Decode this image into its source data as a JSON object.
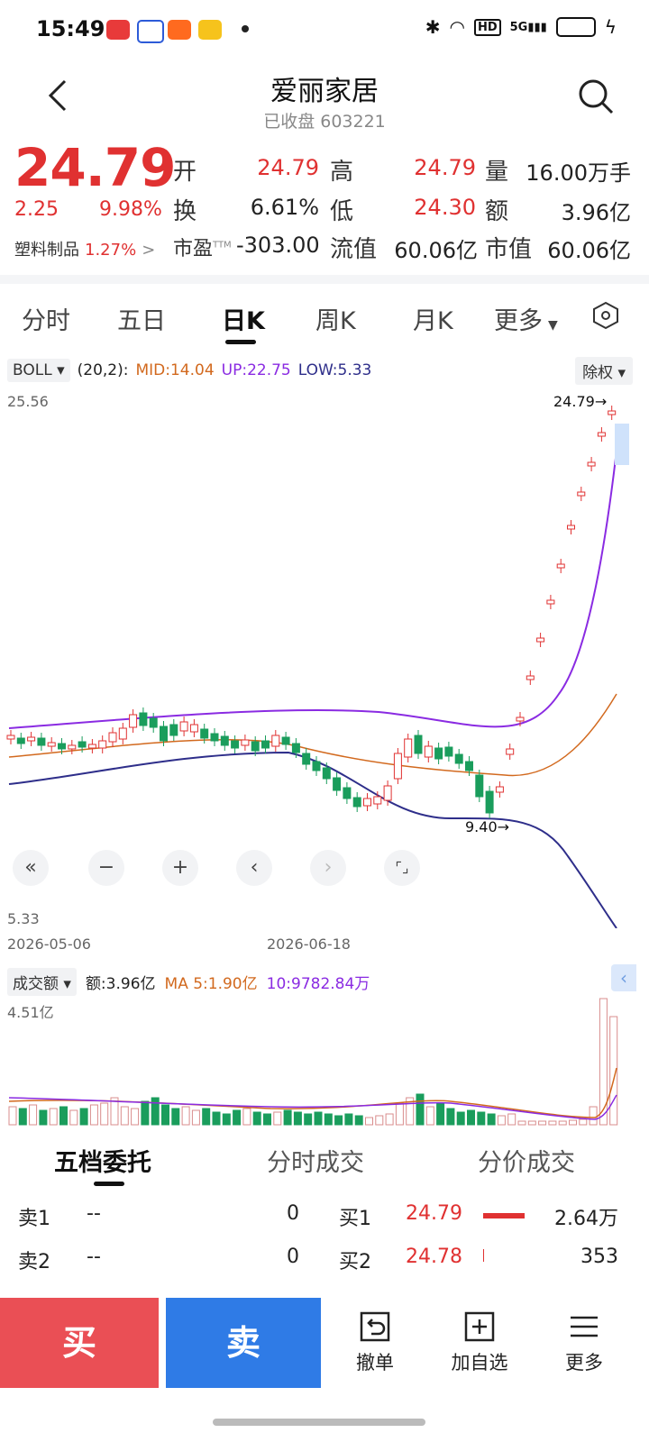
{
  "status_bar": {
    "time": "15:49",
    "network": "5G"
  },
  "header": {
    "title": "爱丽家居",
    "subtitle": "已收盘 603221"
  },
  "quote": {
    "price": "24.79",
    "change": "2.25",
    "change_pct": "9.98%",
    "open_label": "开",
    "open": "24.79",
    "high_label": "高",
    "high": "24.79",
    "volume_label": "量",
    "volume": "16.00万手",
    "turnover_label": "换",
    "turnover": "6.61%",
    "low_label": "低",
    "low": "24.30",
    "amount_label": "额",
    "amount": "3.96亿",
    "pe_label": "市盈",
    "pe_sup": "TTM",
    "pe": "-303.00",
    "float_label": "流值",
    "float_value": "60.06亿",
    "mcap_label": "市值",
    "mcap": "60.06亿",
    "sector": "塑料制品",
    "sector_pct": "1.27%",
    "sector_arrow": ">"
  },
  "tabs": [
    "分时",
    "五日",
    "日K",
    "周K",
    "月K",
    "更多"
  ],
  "active_tab": "日K",
  "indicator": {
    "name": "BOLL",
    "params": "(20,2):",
    "mid": "MID:14.04",
    "up": "UP:22.75",
    "low": "LOW:5.33",
    "adjust": "除权"
  },
  "chart_labels": {
    "y_max": "25.56",
    "y_min": "5.33",
    "high_marker": "24.79",
    "low_marker": "9.40",
    "date_start": "2026-05-06",
    "date_mid": "2026-06-18"
  },
  "volume_panel": {
    "name": "成交额",
    "amount": "额:3.96亿",
    "ma5": "MA 5:1.90亿",
    "ma10": "10:9782.84万",
    "y_max": "4.51亿"
  },
  "chart_data": {
    "type": "candlestick",
    "ylim": [
      5.33,
      25.56
    ],
    "boll": {
      "mid": 14.04,
      "up": 22.75,
      "low": 5.33
    },
    "last_close": 24.79,
    "marked_low": 9.4
  },
  "order_book": {
    "tabs": [
      "五档委托",
      "分时成交",
      "分价成交"
    ],
    "sell": [
      {
        "label": "卖1",
        "price": "--",
        "vol": "0"
      },
      {
        "label": "卖2",
        "price": "--",
        "vol": "0"
      }
    ],
    "buy": [
      {
        "label": "买1",
        "price": "24.79",
        "vol": "2.64万"
      },
      {
        "label": "买2",
        "price": "24.78",
        "vol": "353"
      }
    ]
  },
  "bottom_bar": {
    "buy": "买",
    "sell": "卖",
    "cancel": "撤单",
    "watch": "加自选",
    "more": "更多"
  },
  "colors": {
    "up": "#e03131",
    "down": "#1a9d5c",
    "mid": "#d2691e",
    "upper": "#8a2be2",
    "lower": "#2e2e8a"
  }
}
